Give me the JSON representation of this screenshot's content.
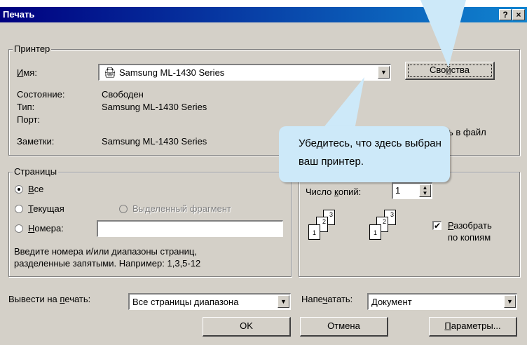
{
  "window": {
    "title": "Печать",
    "help_btn": "?",
    "close_btn": "×"
  },
  "printer": {
    "group_label": "Принтер",
    "name_label_pre": "",
    "name_label_ul": "И",
    "name_label_post": "мя:",
    "name_value": "Samsung ML-1430 Series",
    "properties_btn_pre": "Сво",
    "properties_btn_ul": "й",
    "properties_btn_post": "ства",
    "status_label": "Состояние:",
    "status_value": "Свободен",
    "type_label": "Тип:",
    "type_value": "Samsung ML-1430 Series",
    "port_label": "Порт:",
    "port_value": "",
    "notes_label": "Заметки:",
    "notes_value": "Samsung ML-1430 Series",
    "print_to_file": "ь в файл"
  },
  "pages": {
    "group_label": "Страницы",
    "all_ul": "В",
    "all_post": "се",
    "current_ul": "Т",
    "current_post": "екущая",
    "selection": "Выделенный фрагмент",
    "numbers_ul": "Н",
    "numbers_post": "омера:",
    "numbers_value": "",
    "hint_line1": "Введите номера и/или диапазоны страниц,",
    "hint_line2": "разделенные запятыми. Например: 1,3,5-12"
  },
  "copies": {
    "count_pre": "Число ",
    "count_ul": "к",
    "count_post": "опий:",
    "count_value": "1",
    "collate_ul": "Р",
    "collate_line1_post": "азобрать",
    "collate_line2": "по копиям",
    "collate_checked": "✔"
  },
  "bottom": {
    "print_range_pre": "Вывести на ",
    "print_range_ul": "п",
    "print_range_post": "ечать:",
    "print_range_value": "Все страницы диапазона",
    "print_what_pre": "Напе",
    "print_what_ul": "ч",
    "print_what_post": "атать:",
    "print_what_value": "Документ",
    "ok": "OK",
    "cancel": "Отмена",
    "params_ul": "П",
    "params_post": "араметры..."
  },
  "callout": {
    "line1": "Убедитесь, что здесь выбран",
    "line2": "ваш принтер."
  },
  "colors": {
    "title_start": "#000080",
    "title_end": "#1084d0",
    "dialog_bg": "#d4d0c8",
    "callout_bg": "#cde9f9"
  }
}
